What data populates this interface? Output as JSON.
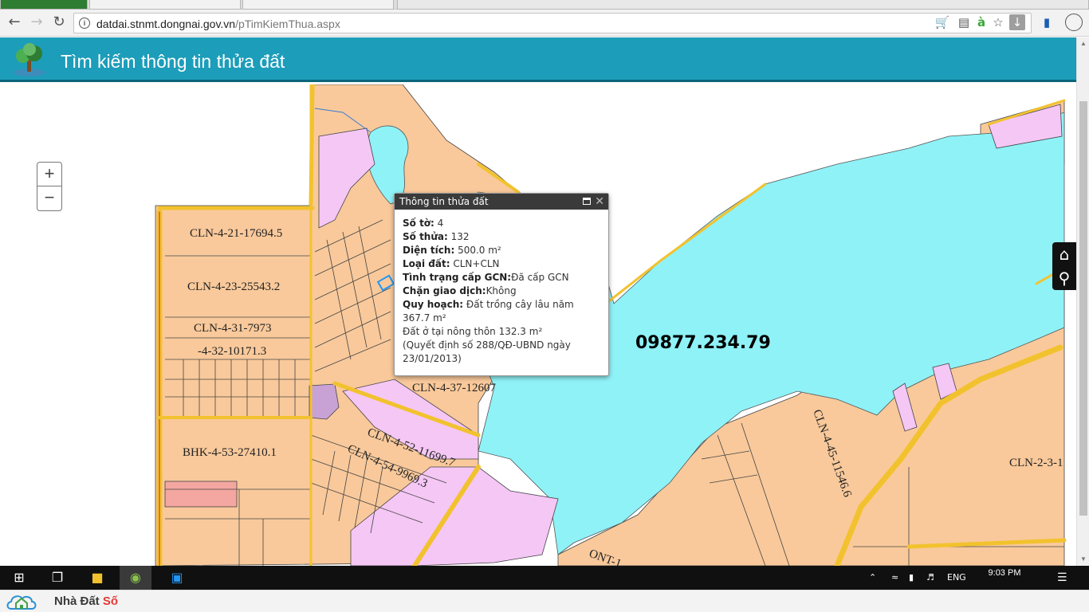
{
  "browser": {
    "url_domain": "datdai.stnmt.dongnai.gov.vn",
    "url_path": "/pTimKiemThua.aspx"
  },
  "app": {
    "title": "Tìm kiếm thông tin thửa đất"
  },
  "map": {
    "zoom_in_label": "+",
    "zoom_out_label": "−",
    "phone_watermark": "09877.234.79",
    "parcel_labels": [
      "CLN-4-21-17694.5",
      "CLN-4-23-25543.2",
      "CLN-4-31-7973",
      "-4-32-10171.3",
      "BHK-4-53-27410.1",
      "CLN-4-37-12607",
      "CLN-4-52-11699.7",
      "CLN-4-54-9969.3",
      "CLN-4-45-11546.6",
      "CLN-2-3-1",
      "ONT-1"
    ]
  },
  "popup": {
    "title": "Thông tin thửa đất",
    "so_to_label": "Số tờ:",
    "so_to_value": "4",
    "so_thua_label": "Số thửa:",
    "so_thua_value": "132",
    "dien_tich_label": "Diện tích:",
    "dien_tich_value": "500.0 m²",
    "loai_dat_label": "Loại đất:",
    "loai_dat_value": "CLN+CLN",
    "tinh_trang_label": "Tình trạng cấp GCN:",
    "tinh_trang_value": "Đã cấp GCN",
    "chan_gd_label": "Chặn giao dịch:",
    "chan_gd_value": "Không",
    "quy_hoach_label": "Quy hoạch:",
    "quy_hoach_value_1": "Đất trồng cây lâu năm 367.7 m²",
    "quy_hoach_value_2": "Đất ở tại nông thôn 132.3 m²",
    "quy_hoach_value_3": "(Quyết định số 288/QĐ-UBND ngày 23/01/2013)"
  },
  "taskbar": {
    "lang": "ENG",
    "time": "9:03 PM"
  },
  "footer": {
    "brand_main": "Nhà Đất ",
    "brand_accent": "Số"
  },
  "colors": {
    "header": "#1c9dba",
    "parcel": "#f9c99b",
    "residential": "#f5c7f5",
    "water": "#8ff2f7",
    "road": "#f2c22e"
  }
}
